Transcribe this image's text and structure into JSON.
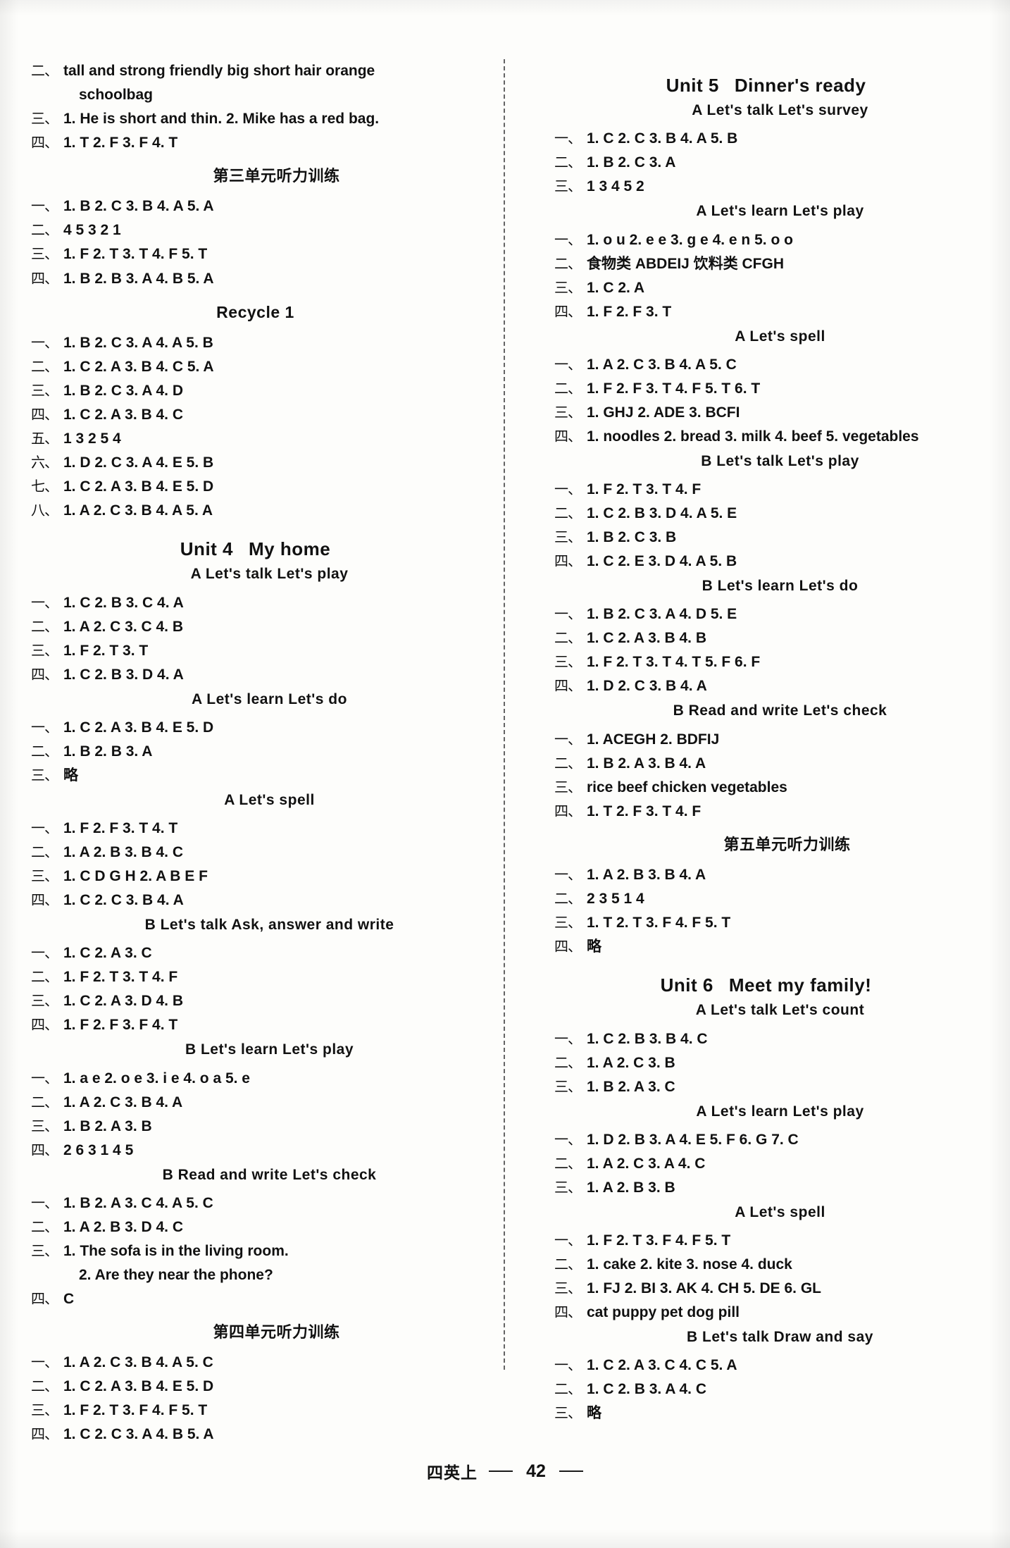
{
  "page": {
    "footer_label": "四英上",
    "page_number": "42"
  },
  "left_column": [
    {
      "kind": "row",
      "num": "二、",
      "vals": "tall and strong   friendly   big   short hair   orange"
    },
    {
      "kind": "cont",
      "text": "schoolbag"
    },
    {
      "kind": "row",
      "num": "三、",
      "vals": "1. He is short and thin.    2. Mike has a red bag."
    },
    {
      "kind": "row",
      "num": "四、",
      "vals": "1. T   2. F   3. F   4. T"
    },
    {
      "kind": "heading_cn",
      "text": "第三单元听力训练"
    },
    {
      "kind": "row",
      "num": "一、",
      "vals": "1. B   2. C   3. B   4. A   5. A"
    },
    {
      "kind": "row",
      "num": "二、",
      "vals": "4 5 3 2 1"
    },
    {
      "kind": "row",
      "num": "三、",
      "vals": "1. F   2. T   3. T   4. F   5. T"
    },
    {
      "kind": "row",
      "num": "四、",
      "vals": "1. B   2. B   3. A   4. B   5. A"
    },
    {
      "kind": "heading",
      "text": "Recycle 1"
    },
    {
      "kind": "row",
      "num": "一、",
      "vals": "1. B   2. C   3. A   4. A   5. B"
    },
    {
      "kind": "row",
      "num": "二、",
      "vals": "1. C   2. A   3. B   4. C   5. A"
    },
    {
      "kind": "row",
      "num": "三、",
      "vals": "1. B   2. C   3. A   4. D"
    },
    {
      "kind": "row",
      "num": "四、",
      "vals": "1. C   2. A   3. B   4. C"
    },
    {
      "kind": "row",
      "num": "五、",
      "vals": "1 3 2 5 4"
    },
    {
      "kind": "row",
      "num": "六、",
      "vals": "1. D   2. C   3. A   4. E   5. B"
    },
    {
      "kind": "row",
      "num": "七、",
      "vals": "1. C   2. A   3. B   4. E   5. D"
    },
    {
      "kind": "row",
      "num": "八、",
      "vals": "1. A   2. C   3. B   4. A   5. A"
    },
    {
      "kind": "heading_unit",
      "text": "Unit 4",
      "text2": "My home"
    },
    {
      "kind": "heading_sub",
      "text": "A   Let's talk   Let's play"
    },
    {
      "kind": "row",
      "num": "一、",
      "vals": "1. C   2. B   3. C   4. A"
    },
    {
      "kind": "row",
      "num": "二、",
      "vals": "1. A   2. C   3. C   4. B"
    },
    {
      "kind": "row",
      "num": "三、",
      "vals": "1. F   2. T   3. T"
    },
    {
      "kind": "row",
      "num": "四、",
      "vals": "1. C   2. B   3. D   4. A"
    },
    {
      "kind": "heading_sub",
      "text": "A   Let's learn   Let's do"
    },
    {
      "kind": "row",
      "num": "一、",
      "vals": "1. C   2. A   3. B   4. E   5. D"
    },
    {
      "kind": "row",
      "num": "二、",
      "vals": "1. B   2. B   3. A"
    },
    {
      "kind": "row",
      "num": "三、",
      "vals": "略"
    },
    {
      "kind": "heading_sub",
      "text": "A   Let's spell"
    },
    {
      "kind": "row",
      "num": "一、",
      "vals": "1. F   2. F   3. T   4. T"
    },
    {
      "kind": "row",
      "num": "二、",
      "vals": "1. A   2. B   3. B   4. C"
    },
    {
      "kind": "row",
      "num": "三、",
      "vals": "1. C   D   G   H   2. A   B   E   F"
    },
    {
      "kind": "row",
      "num": "四、",
      "vals": "1. C   2. C   3. B   4. A"
    },
    {
      "kind": "heading_sub",
      "text": "B   Let's talk   Ask, answer and write"
    },
    {
      "kind": "row",
      "num": "一、",
      "vals": "1. C   2. A   3. C"
    },
    {
      "kind": "row",
      "num": "二、",
      "vals": "1. F   2. T   3. T   4. F"
    },
    {
      "kind": "row",
      "num": "三、",
      "vals": "1. C   2. A   3. D   4. B"
    },
    {
      "kind": "row",
      "num": "四、",
      "vals": "1. F   2. F   3. F   4. T"
    },
    {
      "kind": "heading_sub",
      "text": "B   Let's learn   Let's play"
    },
    {
      "kind": "row",
      "num": "一、",
      "vals": "1. a e   2. o e   3. i e   4. o a   5. e"
    },
    {
      "kind": "row",
      "num": "二、",
      "vals": "1. A   2. C   3. B   4. A"
    },
    {
      "kind": "row",
      "num": "三、",
      "vals": "1. B   2. A   3. B"
    },
    {
      "kind": "row",
      "num": "四、",
      "vals": "2 6 3 1 4 5"
    },
    {
      "kind": "heading_sub",
      "text": "B   Read and write   Let's check"
    },
    {
      "kind": "row",
      "num": "一、",
      "vals": "1. B   2. A   3. C   4. A   5. C"
    },
    {
      "kind": "row",
      "num": "二、",
      "vals": "1. A   2. B   3. D   4. C"
    },
    {
      "kind": "row",
      "num": "三、",
      "vals": "1. The sofa is in the living room."
    },
    {
      "kind": "cont",
      "text": "2. Are they near the phone?"
    },
    {
      "kind": "row",
      "num": "四、",
      "vals": "C"
    },
    {
      "kind": "heading_cn",
      "text": "第四单元听力训练"
    },
    {
      "kind": "row",
      "num": "一、",
      "vals": "1. A   2. C   3. B   4. A   5. C"
    },
    {
      "kind": "row",
      "num": "二、",
      "vals": "1. C   2. A   3. B   4. E   5. D"
    },
    {
      "kind": "row",
      "num": "三、",
      "vals": "1. F   2. T   3. F   4. F   5. T"
    },
    {
      "kind": "row",
      "num": "四、",
      "vals": "1. C   2. C   3. A   4. B   5. A"
    }
  ],
  "right_column": [
    {
      "kind": "heading_unit",
      "text": "Unit 5",
      "text2": "Dinner's ready"
    },
    {
      "kind": "heading_sub",
      "text": "A   Let's talk   Let's survey"
    },
    {
      "kind": "row",
      "num": "一、",
      "vals": "1. C   2. C   3. B   4. A   5. B"
    },
    {
      "kind": "row",
      "num": "二、",
      "vals": "1. B   2. C   3. A"
    },
    {
      "kind": "row",
      "num": "三、",
      "vals": "1 3 4 5 2"
    },
    {
      "kind": "heading_sub",
      "text": "A   Let's learn   Let's play"
    },
    {
      "kind": "row",
      "num": "一、",
      "vals": "1. o u   2. e e   3. g e   4. e n   5. o o"
    },
    {
      "kind": "row",
      "num": "二、",
      "vals": "食物类 ABDEIJ    饮料类 CFGH"
    },
    {
      "kind": "row",
      "num": "三、",
      "vals": "1. C   2. A"
    },
    {
      "kind": "row",
      "num": "四、",
      "vals": "1. F   2. F   3. T"
    },
    {
      "kind": "heading_sub",
      "text": "A   Let's spell"
    },
    {
      "kind": "row",
      "num": "一、",
      "vals": "1. A   2. C   3. B   4. A   5. C"
    },
    {
      "kind": "row",
      "num": "二、",
      "vals": "1. F   2. F   3. T   4. F   5. T   6. T"
    },
    {
      "kind": "row",
      "num": "三、",
      "vals": "1. GHJ      2. ADE    3. BCFI"
    },
    {
      "kind": "row",
      "num": "四、",
      "vals": "1. noodles   2. bread   3. milk   4. beef   5. vegetables"
    },
    {
      "kind": "heading_sub",
      "text": "B   Let's talk   Let's play"
    },
    {
      "kind": "row",
      "num": "一、",
      "vals": "1. F   2. T   3. T   4. F"
    },
    {
      "kind": "row",
      "num": "二、",
      "vals": "1. C   2. B   3. D   4. A   5. E"
    },
    {
      "kind": "row",
      "num": "三、",
      "vals": "1. B   2. C   3. B"
    },
    {
      "kind": "row",
      "num": "四、",
      "vals": "1. C   2. E   3. D   4. A   5. B"
    },
    {
      "kind": "heading_sub",
      "text": "B   Let's learn   Let's do"
    },
    {
      "kind": "row",
      "num": "一、",
      "vals": "1. B   2. C   3. A   4. D   5. E"
    },
    {
      "kind": "row",
      "num": "二、",
      "vals": "1. C   2. A   3. B   4. B"
    },
    {
      "kind": "row",
      "num": "三、",
      "vals": "1. F   2. T   3. T   4. T   5. F   6. F"
    },
    {
      "kind": "row",
      "num": "四、",
      "vals": "1. D   2. C   3. B   4. A"
    },
    {
      "kind": "heading_sub",
      "text": "B   Read and write   Let's check"
    },
    {
      "kind": "row",
      "num": "一、",
      "vals": "1. ACEGH   2. BDFIJ"
    },
    {
      "kind": "row",
      "num": "二、",
      "vals": "1. B   2. A   3. B   4. A"
    },
    {
      "kind": "row",
      "num": "三、",
      "vals": "rice   beef   chicken   vegetables"
    },
    {
      "kind": "row",
      "num": "四、",
      "vals": "1. T   2. F   3. T   4. F"
    },
    {
      "kind": "heading_cn",
      "text": "第五单元听力训练"
    },
    {
      "kind": "row",
      "num": "一、",
      "vals": "1. A   2. B   3. B   4. A"
    },
    {
      "kind": "row",
      "num": "二、",
      "vals": "2 3 5 1 4"
    },
    {
      "kind": "row",
      "num": "三、",
      "vals": "1. T   2. T   3. F   4. F   5. T"
    },
    {
      "kind": "row",
      "num": "四、",
      "vals": "略"
    },
    {
      "kind": "heading_unit",
      "text": "Unit 6",
      "text2": "Meet my family!"
    },
    {
      "kind": "heading_sub",
      "text": "A   Let's talk   Let's count"
    },
    {
      "kind": "row",
      "num": "一、",
      "vals": "1. C   2. B   3. B   4. C"
    },
    {
      "kind": "row",
      "num": "二、",
      "vals": "1. A   2. C   3. B"
    },
    {
      "kind": "row",
      "num": "三、",
      "vals": "1. B   2. A   3. C"
    },
    {
      "kind": "heading_sub",
      "text": "A   Let's learn   Let's play"
    },
    {
      "kind": "row",
      "num": "一、",
      "vals": "1. D   2. B   3. A   4. E   5. F   6. G   7. C"
    },
    {
      "kind": "row",
      "num": "二、",
      "vals": "1. A   2. C   3. A   4. C"
    },
    {
      "kind": "row",
      "num": "三、",
      "vals": "1. A   2. B   3. B"
    },
    {
      "kind": "heading_sub",
      "text": "A   Let's spell"
    },
    {
      "kind": "row",
      "num": "一、",
      "vals": "1. F   2. T   3. F   4. F   5. T"
    },
    {
      "kind": "row",
      "num": "二、",
      "vals": "1. cake   2. kite   3. nose   4. duck"
    },
    {
      "kind": "row",
      "num": "三、",
      "vals": "1. FJ   2. BI   3. AK   4. CH   5. DE   6. GL"
    },
    {
      "kind": "row",
      "num": "四、",
      "vals": "cat   puppy   pet   dog   pill"
    },
    {
      "kind": "heading_sub",
      "text": "B   Let's talk   Draw and say"
    },
    {
      "kind": "row",
      "num": "一、",
      "vals": "1. C   2. A   3. C   4. C   5. A"
    },
    {
      "kind": "row",
      "num": "二、",
      "vals": "1. C   2. B   3. A   4. C"
    },
    {
      "kind": "row",
      "num": "三、",
      "vals": "略"
    }
  ]
}
